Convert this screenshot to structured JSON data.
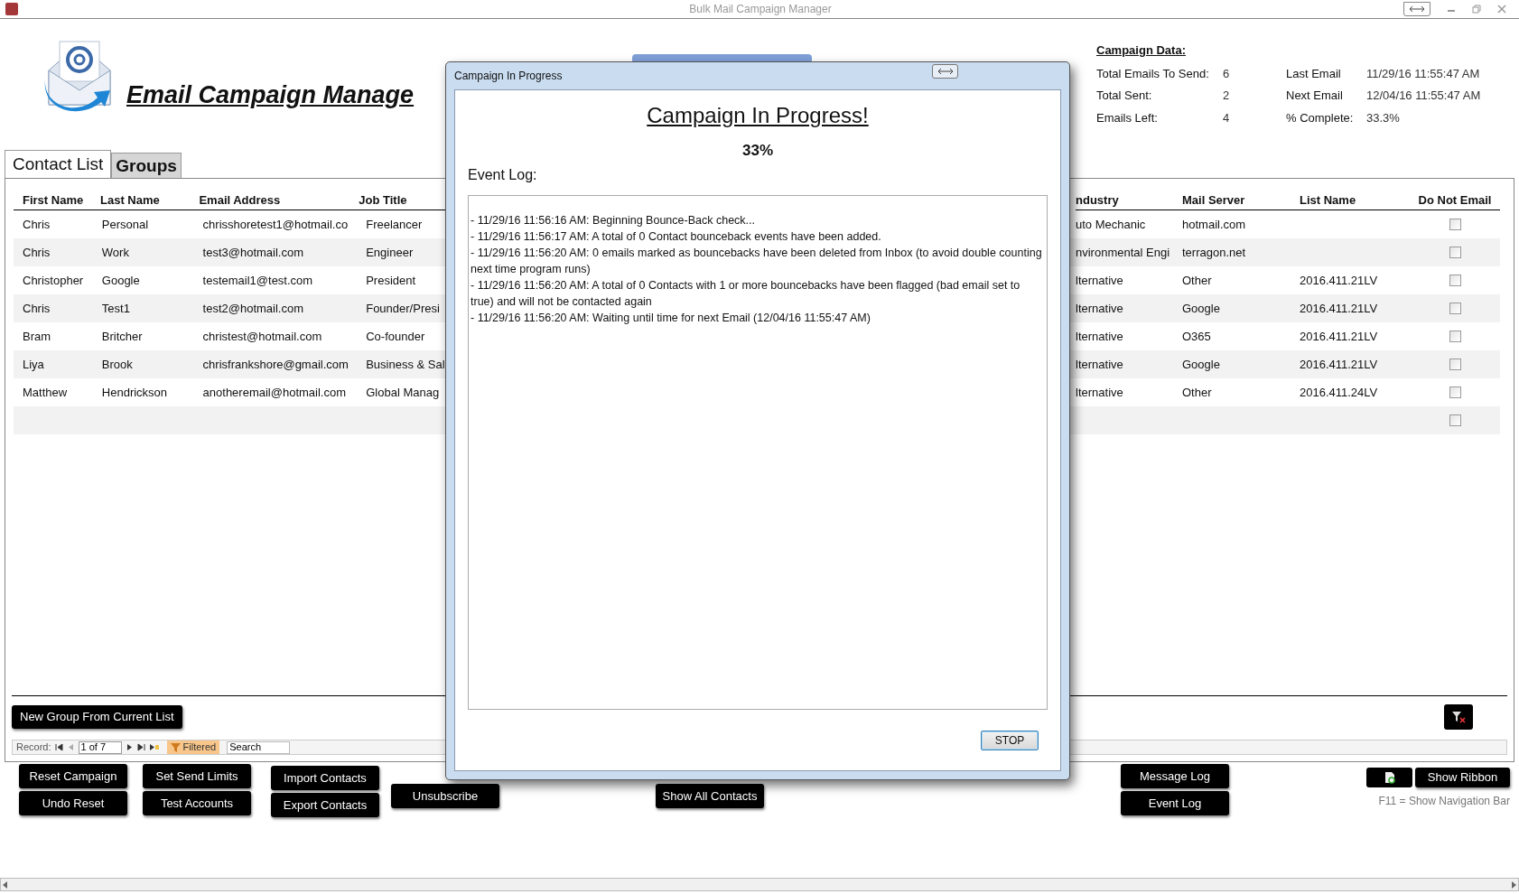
{
  "window": {
    "title": "Bulk Mail Campaign Manager"
  },
  "header": {
    "title": "Email Campaign Manage"
  },
  "campaign_data": {
    "heading": "Campaign Data:",
    "left": [
      {
        "label": "Total Emails To Send:",
        "value": "6"
      },
      {
        "label": "Total Sent:",
        "value": "2"
      },
      {
        "label": "Emails Left:",
        "value": "4"
      }
    ],
    "right": [
      {
        "label": "Last Email",
        "value": "11/29/16 11:55:47 AM"
      },
      {
        "label": "Next Email",
        "value": "12/04/16 11:55:47 AM"
      },
      {
        "label": "% Complete:",
        "value": "33.3%"
      }
    ]
  },
  "tabs": [
    {
      "label": "Contact List",
      "selected": true
    },
    {
      "label": "Groups",
      "selected": false
    }
  ],
  "table": {
    "left_columns": [
      "First Name",
      "Last Name",
      "Email Address",
      "Job Title"
    ],
    "right_columns": [
      "ndustry",
      "Mail Server",
      "List Name",
      "Do Not Email"
    ],
    "rows": [
      {
        "left": [
          "Chris",
          "Personal",
          "chrisshoretest1@hotmail.co",
          "Freelancer"
        ],
        "right": [
          "uto Mechanic",
          "hotmail.com"
        ],
        "do_not_email": false
      },
      {
        "left": [
          "Chris",
          "Work",
          "test3@hotmail.com",
          "Engineer"
        ],
        "right": [
          "nvironmental Engi",
          "terragon.net"
        ],
        "do_not_email": false
      },
      {
        "left": [
          "Christopher",
          "Google",
          "testemail1@test.com",
          "President"
        ],
        "right": [
          "lternative",
          "Other",
          "2016.411.21LV"
        ],
        "do_not_email": false
      },
      {
        "left": [
          "Chris",
          "Test1",
          "test2@hotmail.com",
          "Founder/Presi"
        ],
        "right": [
          "lternative",
          "Google",
          "2016.411.21LV"
        ],
        "do_not_email": false
      },
      {
        "left": [
          "Bram",
          "Britcher",
          "christest@hotmail.com",
          "Co-founder"
        ],
        "right": [
          "lternative",
          "O365",
          "2016.411.21LV"
        ],
        "do_not_email": false
      },
      {
        "left": [
          "Liya",
          "Brook",
          "chrisfrankshore@gmail.com",
          "Business & Sal"
        ],
        "right": [
          "lternative",
          "Google",
          "2016.411.21LV"
        ],
        "do_not_email": false
      },
      {
        "left": [
          "Matthew",
          "Hendrickson",
          "anotheremail@hotmail.com",
          "Global Manag"
        ],
        "right": [
          "lternative",
          "Other",
          "2016.411.24LV"
        ],
        "do_not_email": false
      }
    ],
    "new_record_row": {
      "do_not_email": false
    }
  },
  "new_group_button": "New Group From Current List",
  "record_nav": {
    "label": "Record:",
    "position": "1 of 7",
    "filter": "Filtered",
    "search_placeholder": "Search"
  },
  "button_columns": [
    [
      "Reset Campaign",
      "Undo Reset"
    ],
    [
      "Set Send Limits",
      "Test Accounts"
    ],
    [
      "Import Contacts",
      "Export Contacts"
    ],
    [
      "Unsubscribe"
    ],
    [
      "Show All Contacts"
    ],
    [
      "Message Log",
      "Event Log"
    ]
  ],
  "ribbon_button": "Show Ribbon",
  "hint": "F11 = Show Navigation Bar",
  "dialog": {
    "title": "Campaign In Progress",
    "heading": "Campaign In Progress!",
    "percent": "33%",
    "log_label": "Event Log:",
    "log": [
      "- 11/29/16 11:56:16 AM: Beginning Bounce-Back check...",
      "- 11/29/16 11:56:17 AM: A total of 0 Contact bounceback events have been added.",
      "- 11/29/16 11:56:20 AM: 0 emails marked as bouncebacks have been deleted from Inbox (to avoid double counting next time program runs)",
      "- 11/29/16 11:56:20 AM: A total of 0 Contacts with 1 or more bouncebacks have been flagged (bad email set to true) and will not be contacted again",
      "- 11/29/16 11:56:20 AM: Waiting until time for next Email (12/04/16 11:55:47 AM)"
    ],
    "stop_button": "STOP"
  }
}
